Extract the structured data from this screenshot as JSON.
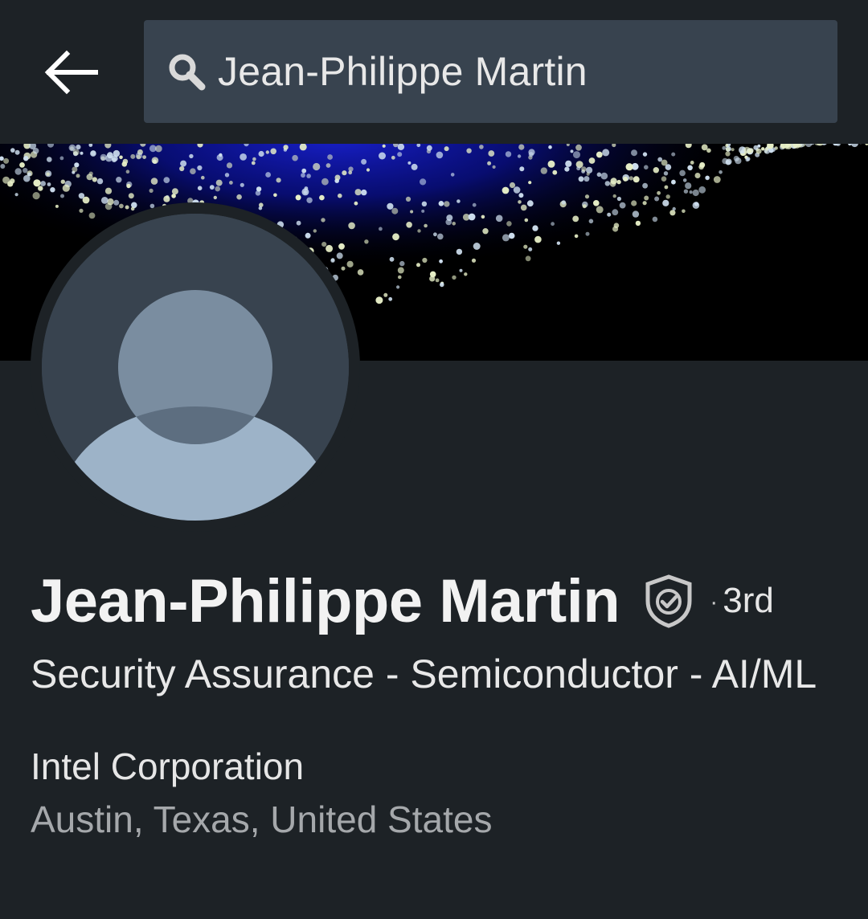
{
  "search": {
    "query": "Jean-Philippe Martin"
  },
  "profile": {
    "name": "Jean-Philippe Martin",
    "connection_degree": "3rd",
    "headline": "Security Assurance - Semiconductor - AI/ML",
    "company": "Intel Corporation",
    "location": "Austin, Texas, United States"
  },
  "icons": {
    "back": "back-arrow-icon",
    "search": "search-icon",
    "verified": "verified-shield-icon",
    "avatar": "default-person-avatar"
  },
  "colors": {
    "background": "#1d2226",
    "search_field": "#38434f",
    "avatar_bg": "#38434f",
    "avatar_figure": "#9db3c8",
    "secondary_text": "#a5a8ab",
    "banner_glow": "#1a22d8"
  }
}
